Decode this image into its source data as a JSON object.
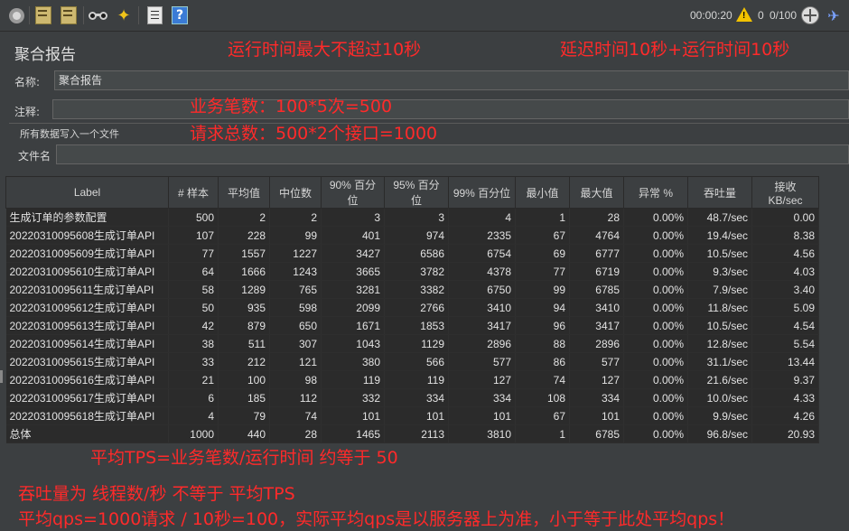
{
  "toolbar": {
    "buttons": [
      {
        "name": "stop-icon",
        "glyph": "●",
        "color": "#b0b0b0"
      },
      {
        "name": "clear-icon",
        "glyph": "✎",
        "color": "#d9c27a"
      },
      {
        "name": "clear-all-icon",
        "glyph": "✎",
        "color": "#d9c27a"
      },
      {
        "name": "search-icon",
        "glyph": "⚲",
        "color": "#cfcfcf"
      },
      {
        "name": "reset-search-icon",
        "glyph": "✦",
        "color": "#f0c419"
      },
      {
        "name": "function-helper-icon",
        "glyph": "☰",
        "color": "#e6e6e6"
      },
      {
        "name": "help-icon",
        "glyph": "?",
        "color": "#ffffff"
      }
    ],
    "elapsed": "00:00:20",
    "warning_count": "0",
    "threads": "0/100"
  },
  "panel": {
    "title": "聚合报告",
    "name_label": "名称:",
    "name_value": "聚合报告",
    "comment_label": "注释:",
    "comment_value": "",
    "write_all_label": "所有数据写入一个文件",
    "filename_label": "文件名",
    "filename_value": ""
  },
  "table": {
    "headers": [
      "Label",
      "# 样本",
      "平均值",
      "中位数",
      "90% 百分位",
      "95% 百分位",
      "99% 百分位",
      "最小值",
      "最大值",
      "异常 %",
      "吞吐量",
      "接收 KB/sec"
    ],
    "rows": [
      [
        "生成订单的参数配置",
        "500",
        "2",
        "2",
        "3",
        "3",
        "4",
        "1",
        "28",
        "0.00%",
        "48.7/sec",
        "0.00"
      ],
      [
        "20220310095608生成订单API",
        "107",
        "228",
        "99",
        "401",
        "974",
        "2335",
        "67",
        "4764",
        "0.00%",
        "19.4/sec",
        "8.38"
      ],
      [
        "20220310095609生成订单API",
        "77",
        "1557",
        "1227",
        "3427",
        "6586",
        "6754",
        "69",
        "6777",
        "0.00%",
        "10.5/sec",
        "4.56"
      ],
      [
        "20220310095610生成订单API",
        "64",
        "1666",
        "1243",
        "3665",
        "3782",
        "4378",
        "77",
        "6719",
        "0.00%",
        "9.3/sec",
        "4.03"
      ],
      [
        "20220310095611生成订单API",
        "58",
        "1289",
        "765",
        "3281",
        "3382",
        "6750",
        "99",
        "6785",
        "0.00%",
        "7.9/sec",
        "3.40"
      ],
      [
        "20220310095612生成订单API",
        "50",
        "935",
        "598",
        "2099",
        "2766",
        "3410",
        "94",
        "3410",
        "0.00%",
        "11.8/sec",
        "5.09"
      ],
      [
        "20220310095613生成订单API",
        "42",
        "879",
        "650",
        "1671",
        "1853",
        "3417",
        "96",
        "3417",
        "0.00%",
        "10.5/sec",
        "4.54"
      ],
      [
        "20220310095614生成订单API",
        "38",
        "511",
        "307",
        "1043",
        "1129",
        "2896",
        "88",
        "2896",
        "0.00%",
        "12.8/sec",
        "5.54"
      ],
      [
        "20220310095615生成订单API",
        "33",
        "212",
        "121",
        "380",
        "566",
        "577",
        "86",
        "577",
        "0.00%",
        "31.1/sec",
        "13.44"
      ],
      [
        "20220310095616生成订单API",
        "21",
        "100",
        "98",
        "119",
        "119",
        "127",
        "74",
        "127",
        "0.00%",
        "21.6/sec",
        "9.37"
      ],
      [
        "20220310095617生成订单API",
        "6",
        "185",
        "112",
        "332",
        "334",
        "334",
        "108",
        "334",
        "0.00%",
        "10.0/sec",
        "4.33"
      ],
      [
        "20220310095618生成订单API",
        "4",
        "79",
        "74",
        "101",
        "101",
        "101",
        "67",
        "101",
        "0.00%",
        "9.9/sec",
        "4.26"
      ],
      [
        "总体",
        "1000",
        "440",
        "28",
        "1465",
        "2113",
        "3810",
        "1",
        "6785",
        "0.00%",
        "96.8/sec",
        "20.93"
      ]
    ]
  },
  "annotations": {
    "a1": "运行时间最大不超过10秒",
    "a2": "延迟时间10秒+运行时间10秒",
    "a3": "业务笔数：100*5次=500",
    "a4": "请求总数：500*2个接口=1000",
    "a5": "平均TPS=业务笔数/运行时间   约等于 50",
    "a6": "吞吐量为 线程数/秒  不等于  平均TPS",
    "a7": "平均qps=1000请求 / 10秒=100，实际平均qps是以服务器上为准，小于等于此处平均qps！"
  },
  "colors": {
    "annotation": "#ff2a2a",
    "background": "#3c3f41",
    "table_row": "#2b2b2b"
  }
}
